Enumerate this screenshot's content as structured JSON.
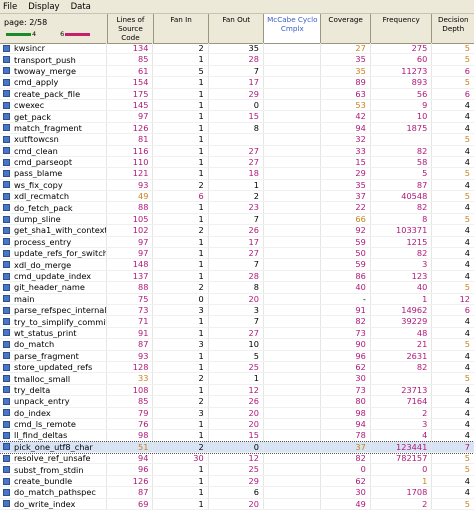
{
  "menu": [
    "File",
    "Display",
    "Data"
  ],
  "page": {
    "label": "page: 2/58",
    "legend_low": "4",
    "legend_high": "6",
    "legend_colors": [
      "#1a8a2a",
      "#c81e6e"
    ]
  },
  "columns": [
    {
      "label": "Lines of Source Code",
      "style": "normal"
    },
    {
      "label": "Fan In",
      "style": "normal"
    },
    {
      "label": "Fan Out",
      "style": "normal"
    },
    {
      "label": "McCabe Cyclo Cmplx",
      "style": "blue"
    },
    {
      "label": "Coverage",
      "style": "normal"
    },
    {
      "label": "Frequency",
      "style": "normal"
    },
    {
      "label": "Decision Depth",
      "style": "normal"
    }
  ],
  "colors": {
    "magenta": "#b0187a",
    "black": "#000000",
    "orange": "#c8841a"
  },
  "rows": [
    {
      "name": "kwsincr",
      "v": [
        [
          "134",
          "m"
        ],
        [
          "2",
          "b"
        ],
        [
          "35",
          "b"
        ],
        [
          "27",
          "o"
        ],
        [
          "275",
          "m"
        ],
        [
          "5",
          "o"
        ]
      ]
    },
    {
      "name": "transport_push",
      "v": [
        [
          "85",
          "m"
        ],
        [
          "1",
          "b"
        ],
        [
          "28",
          "m"
        ],
        [
          "35",
          "m"
        ],
        [
          "60",
          "m"
        ],
        [
          "5",
          "o"
        ]
      ]
    },
    {
      "name": "twoway_merge",
      "v": [
        [
          "61",
          "m"
        ],
        [
          "5",
          "b"
        ],
        [
          "7",
          "b"
        ],
        [
          "35",
          "o"
        ],
        [
          "11273",
          "m"
        ],
        [
          "6",
          "m"
        ]
      ]
    },
    {
      "name": "cmd_apply",
      "v": [
        [
          "154",
          "m"
        ],
        [
          "1",
          "b"
        ],
        [
          "17",
          "m"
        ],
        [
          "89",
          "m"
        ],
        [
          "893",
          "m"
        ],
        [
          "5",
          "o"
        ]
      ]
    },
    {
      "name": "create_pack_file",
      "v": [
        [
          "175",
          "m"
        ],
        [
          "1",
          "b"
        ],
        [
          "29",
          "m"
        ],
        [
          "63",
          "m"
        ],
        [
          "56",
          "m"
        ],
        [
          "6",
          "m"
        ]
      ]
    },
    {
      "name": "cwexec",
      "v": [
        [
          "145",
          "m"
        ],
        [
          "1",
          "b"
        ],
        [
          "0",
          "b"
        ],
        [
          "53",
          "o"
        ],
        [
          "9",
          "m"
        ],
        [
          "4",
          "b"
        ]
      ]
    },
    {
      "name": "get_pack",
      "v": [
        [
          "97",
          "m"
        ],
        [
          "1",
          "b"
        ],
        [
          "15",
          "m"
        ],
        [
          "42",
          "m"
        ],
        [
          "10",
          "m"
        ],
        [
          "4",
          "b"
        ]
      ]
    },
    {
      "name": "match_fragment",
      "v": [
        [
          "126",
          "m"
        ],
        [
          "1",
          "b"
        ],
        [
          "8",
          "b"
        ],
        [
          "94",
          "m"
        ],
        [
          "1875",
          "m"
        ],
        [
          "4",
          "b"
        ]
      ]
    },
    {
      "name": "xutftowcsn",
      "v": [
        [
          "81",
          "m"
        ],
        [
          "1",
          "b"
        ],
        [
          "",
          "b"
        ],
        [
          "32",
          "m"
        ],
        [
          "",
          "b"
        ],
        [
          "5",
          "o"
        ]
      ]
    },
    {
      "name": "cmd_clean",
      "v": [
        [
          "116",
          "m"
        ],
        [
          "1",
          "b"
        ],
        [
          "27",
          "m"
        ],
        [
          "33",
          "m"
        ],
        [
          "82",
          "m"
        ],
        [
          "4",
          "b"
        ]
      ]
    },
    {
      "name": "cmd_parseopt",
      "v": [
        [
          "110",
          "m"
        ],
        [
          "1",
          "b"
        ],
        [
          "27",
          "m"
        ],
        [
          "15",
          "m"
        ],
        [
          "58",
          "m"
        ],
        [
          "4",
          "b"
        ]
      ]
    },
    {
      "name": "pass_blame",
      "v": [
        [
          "121",
          "m"
        ],
        [
          "1",
          "b"
        ],
        [
          "18",
          "m"
        ],
        [
          "29",
          "m"
        ],
        [
          "5",
          "m"
        ],
        [
          "5",
          "o"
        ]
      ]
    },
    {
      "name": "ws_fix_copy",
      "v": [
        [
          "93",
          "m"
        ],
        [
          "2",
          "b"
        ],
        [
          "1",
          "b"
        ],
        [
          "35",
          "m"
        ],
        [
          "87",
          "m"
        ],
        [
          "4",
          "b"
        ]
      ]
    },
    {
      "name": "xdl_recmatch",
      "v": [
        [
          "49",
          "o"
        ],
        [
          "6",
          "m"
        ],
        [
          "2",
          "b"
        ],
        [
          "37",
          "m"
        ],
        [
          "40548",
          "m"
        ],
        [
          "5",
          "o"
        ]
      ]
    },
    {
      "name": "do_fetch_pack",
      "v": [
        [
          "88",
          "m"
        ],
        [
          "1",
          "b"
        ],
        [
          "23",
          "m"
        ],
        [
          "22",
          "m"
        ],
        [
          "82",
          "m"
        ],
        [
          "4",
          "b"
        ]
      ]
    },
    {
      "name": "dump_sline",
      "v": [
        [
          "105",
          "m"
        ],
        [
          "1",
          "b"
        ],
        [
          "7",
          "b"
        ],
        [
          "66",
          "o"
        ],
        [
          "8",
          "m"
        ],
        [
          "5",
          "o"
        ]
      ]
    },
    {
      "name": "get_sha1_with_context_1",
      "v": [
        [
          "102",
          "m"
        ],
        [
          "2",
          "b"
        ],
        [
          "26",
          "m"
        ],
        [
          "92",
          "m"
        ],
        [
          "103371",
          "m"
        ],
        [
          "4",
          "b"
        ]
      ]
    },
    {
      "name": "process_entry",
      "v": [
        [
          "97",
          "m"
        ],
        [
          "1",
          "b"
        ],
        [
          "17",
          "m"
        ],
        [
          "59",
          "m"
        ],
        [
          "1215",
          "m"
        ],
        [
          "4",
          "b"
        ]
      ]
    },
    {
      "name": "update_refs_for_switch",
      "v": [
        [
          "97",
          "m"
        ],
        [
          "1",
          "b"
        ],
        [
          "27",
          "m"
        ],
        [
          "50",
          "m"
        ],
        [
          "82",
          "m"
        ],
        [
          "4",
          "b"
        ]
      ]
    },
    {
      "name": "xdl_do_merge",
      "v": [
        [
          "148",
          "m"
        ],
        [
          "1",
          "b"
        ],
        [
          "7",
          "b"
        ],
        [
          "59",
          "m"
        ],
        [
          "3",
          "m"
        ],
        [
          "4",
          "b"
        ]
      ]
    },
    {
      "name": "cmd_update_index",
      "v": [
        [
          "137",
          "m"
        ],
        [
          "1",
          "b"
        ],
        [
          "28",
          "m"
        ],
        [
          "86",
          "m"
        ],
        [
          "123",
          "m"
        ],
        [
          "4",
          "b"
        ]
      ]
    },
    {
      "name": "git_header_name",
      "v": [
        [
          "88",
          "m"
        ],
        [
          "2",
          "b"
        ],
        [
          "8",
          "b"
        ],
        [
          "40",
          "m"
        ],
        [
          "40",
          "m"
        ],
        [
          "5",
          "o"
        ]
      ]
    },
    {
      "name": "main",
      "v": [
        [
          "75",
          "m"
        ],
        [
          "0",
          "b"
        ],
        [
          "20",
          "m"
        ],
        [
          "-",
          "b"
        ],
        [
          "1",
          "m"
        ],
        [
          "12",
          "m"
        ]
      ]
    },
    {
      "name": "parse_refspec_internal",
      "v": [
        [
          "73",
          "m"
        ],
        [
          "3",
          "b"
        ],
        [
          "3",
          "b"
        ],
        [
          "91",
          "m"
        ],
        [
          "14962",
          "m"
        ],
        [
          "6",
          "m"
        ]
      ]
    },
    {
      "name": "try_to_simplify_commit",
      "v": [
        [
          "71",
          "m"
        ],
        [
          "1",
          "b"
        ],
        [
          "7",
          "b"
        ],
        [
          "82",
          "m"
        ],
        [
          "39229",
          "m"
        ],
        [
          "4",
          "b"
        ]
      ]
    },
    {
      "name": "wt_status_print",
      "v": [
        [
          "91",
          "m"
        ],
        [
          "1",
          "b"
        ],
        [
          "27",
          "m"
        ],
        [
          "73",
          "m"
        ],
        [
          "48",
          "m"
        ],
        [
          "4",
          "b"
        ]
      ]
    },
    {
      "name": "do_match",
      "v": [
        [
          "87",
          "m"
        ],
        [
          "3",
          "b"
        ],
        [
          "10",
          "b"
        ],
        [
          "90",
          "m"
        ],
        [
          "21",
          "m"
        ],
        [
          "5",
          "o"
        ]
      ]
    },
    {
      "name": "parse_fragment",
      "v": [
        [
          "93",
          "m"
        ],
        [
          "1",
          "b"
        ],
        [
          "5",
          "b"
        ],
        [
          "96",
          "m"
        ],
        [
          "2631",
          "m"
        ],
        [
          "4",
          "b"
        ]
      ]
    },
    {
      "name": "store_updated_refs",
      "v": [
        [
          "128",
          "m"
        ],
        [
          "1",
          "b"
        ],
        [
          "25",
          "m"
        ],
        [
          "62",
          "m"
        ],
        [
          "82",
          "m"
        ],
        [
          "4",
          "b"
        ]
      ]
    },
    {
      "name": "tmalloc_small",
      "v": [
        [
          "33",
          "o"
        ],
        [
          "2",
          "b"
        ],
        [
          "1",
          "b"
        ],
        [
          "30",
          "m"
        ],
        [
          "",
          "b"
        ],
        [
          "5",
          "o"
        ]
      ]
    },
    {
      "name": "try_delta",
      "v": [
        [
          "108",
          "m"
        ],
        [
          "1",
          "b"
        ],
        [
          "12",
          "m"
        ],
        [
          "73",
          "m"
        ],
        [
          "23713",
          "m"
        ],
        [
          "4",
          "b"
        ]
      ]
    },
    {
      "name": "unpack_entry",
      "v": [
        [
          "85",
          "m"
        ],
        [
          "2",
          "b"
        ],
        [
          "26",
          "m"
        ],
        [
          "80",
          "m"
        ],
        [
          "7164",
          "m"
        ],
        [
          "4",
          "b"
        ]
      ]
    },
    {
      "name": "do_index",
      "v": [
        [
          "79",
          "m"
        ],
        [
          "3",
          "b"
        ],
        [
          "20",
          "m"
        ],
        [
          "98",
          "m"
        ],
        [
          "2",
          "m"
        ],
        [
          "4",
          "b"
        ]
      ]
    },
    {
      "name": "cmd_ls_remote",
      "v": [
        [
          "76",
          "m"
        ],
        [
          "1",
          "b"
        ],
        [
          "20",
          "m"
        ],
        [
          "94",
          "m"
        ],
        [
          "3",
          "m"
        ],
        [
          "4",
          "b"
        ]
      ]
    },
    {
      "name": "ll_find_deltas",
      "v": [
        [
          "98",
          "m"
        ],
        [
          "1",
          "b"
        ],
        [
          "15",
          "m"
        ],
        [
          "78",
          "m"
        ],
        [
          "4",
          "m"
        ],
        [
          "4",
          "b"
        ]
      ]
    },
    {
      "name": "pick_one_utf8_char",
      "v": [
        [
          "51",
          "o"
        ],
        [
          "2",
          "b"
        ],
        [
          "0",
          "b"
        ],
        [
          "37",
          "o"
        ],
        [
          "123441",
          "m"
        ],
        [
          "7",
          "m"
        ]
      ],
      "selected": true
    },
    {
      "name": "resolve_ref_unsafe",
      "v": [
        [
          "94",
          "m"
        ],
        [
          "30",
          "m"
        ],
        [
          "12",
          "m"
        ],
        [
          "82",
          "m"
        ],
        [
          "782157",
          "m"
        ],
        [
          "5",
          "o"
        ]
      ]
    },
    {
      "name": "subst_from_stdin",
      "v": [
        [
          "96",
          "m"
        ],
        [
          "1",
          "b"
        ],
        [
          "25",
          "m"
        ],
        [
          "0",
          "m"
        ],
        [
          "0",
          "m"
        ],
        [
          "5",
          "o"
        ]
      ]
    },
    {
      "name": "create_bundle",
      "v": [
        [
          "126",
          "m"
        ],
        [
          "1",
          "b"
        ],
        [
          "29",
          "m"
        ],
        [
          "62",
          "m"
        ],
        [
          "1",
          "o"
        ],
        [
          "4",
          "b"
        ]
      ]
    },
    {
      "name": "do_match_pathspec",
      "v": [
        [
          "87",
          "m"
        ],
        [
          "1",
          "b"
        ],
        [
          "6",
          "b"
        ],
        [
          "30",
          "m"
        ],
        [
          "1708",
          "m"
        ],
        [
          "4",
          "b"
        ]
      ]
    },
    {
      "name": "do_write_index",
      "v": [
        [
          "69",
          "m"
        ],
        [
          "1",
          "b"
        ],
        [
          "20",
          "m"
        ],
        [
          "49",
          "m"
        ],
        [
          "2",
          "m"
        ],
        [
          "5",
          "o"
        ]
      ]
    }
  ]
}
